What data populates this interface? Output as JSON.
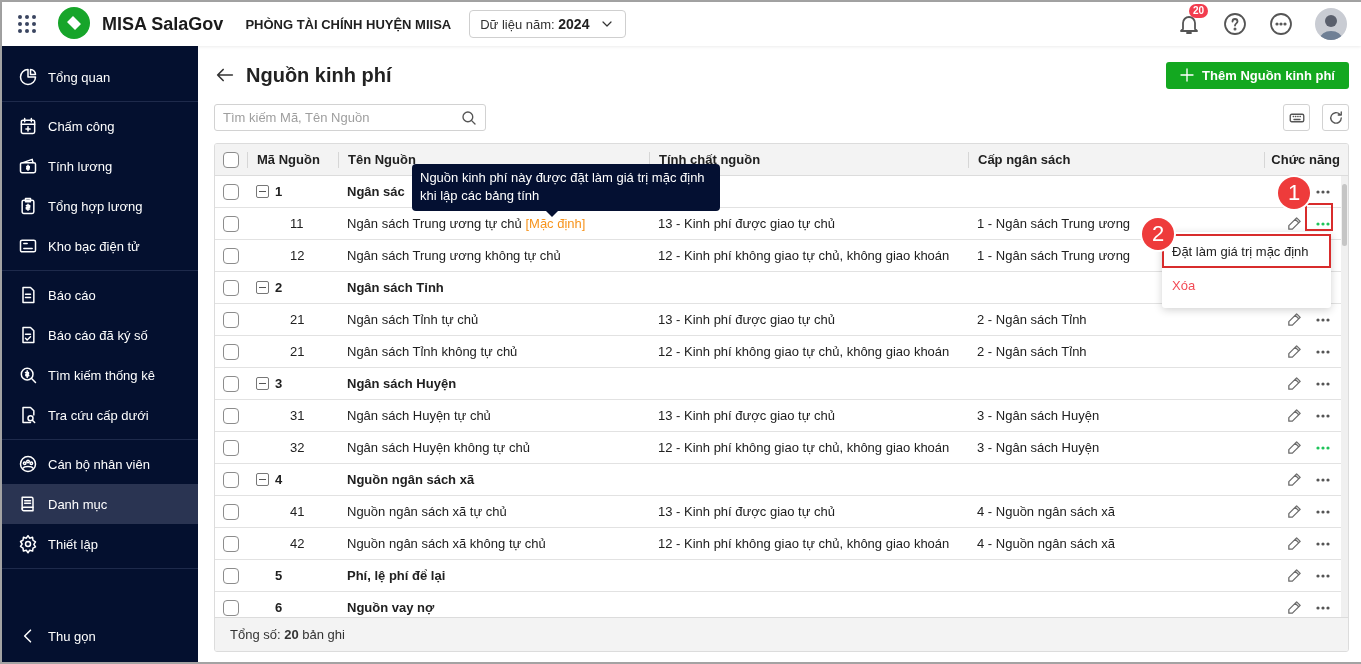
{
  "topbar": {
    "app_name": "MISA SalaGov",
    "org_name": "PHÒNG TÀI CHÍNH HUYỆN MIISA",
    "year_filter": "Dữ liệu năm: **2024**",
    "notification_count": "20"
  },
  "sidebar": {
    "groups": [
      [
        {
          "label": "Tổng quan",
          "selected": false
        }
      ],
      [
        {
          "label": "Chấm công",
          "selected": false
        },
        {
          "label": "Tính lương",
          "selected": false
        },
        {
          "label": "Tổng hợp lương",
          "selected": false
        },
        {
          "label": "Kho bạc điện tử",
          "selected": false
        }
      ],
      [
        {
          "label": "Báo cáo",
          "selected": false
        },
        {
          "label": "Báo cáo đã ký số",
          "selected": false
        },
        {
          "label": "Tìm kiếm thống kê",
          "selected": false
        },
        {
          "label": "Tra cứu cấp dưới",
          "selected": false
        }
      ],
      [
        {
          "label": "Cán bộ nhân viên",
          "selected": false
        },
        {
          "label": "Danh mục",
          "selected": true
        },
        {
          "label": "Thiết lập",
          "selected": false
        }
      ]
    ],
    "collapse_label": "Thu gọn"
  },
  "page": {
    "title": "Nguồn kinh phí",
    "add_button": "Thêm Nguồn kinh phí",
    "search": {
      "placeholder": "Tìm kiếm Mã, Tên Nguồn"
    }
  },
  "table": {
    "header_checked": false,
    "columns": [
      "Mã Nguồn",
      "Tên Nguồn",
      "Tính chất nguồn",
      "Cấp ngân sách",
      "Chức năng"
    ],
    "rows": [
      {
        "kind": "group",
        "expanded": true,
        "checked": false,
        "code": "1",
        "name": "Ngân sác",
        "show_edit": false,
        "show_more": true,
        "more_active": false
      },
      {
        "kind": "item",
        "checked": false,
        "code": "11",
        "name": "Ngân sách Trung ương tự chủ",
        "tag": "[Mặc định]",
        "nature": "13 - Kinh phí được giao tự chủ",
        "level": "1 - Ngân sách Trung ương",
        "show_edit": true,
        "show_more": true,
        "more_active": true
      },
      {
        "kind": "item",
        "checked": false,
        "code": "12",
        "name": "Ngân sách Trung ương không tự chủ",
        "nature": "12 - Kinh phí không giao tự chủ, không giao khoán",
        "level": "1 - Ngân sách Trung ương",
        "show_edit": false,
        "show_more": false
      },
      {
        "kind": "group",
        "expanded": true,
        "checked": false,
        "code": "2",
        "name": "Ngân sách Tỉnh",
        "show_edit": false,
        "show_more": false
      },
      {
        "kind": "item",
        "checked": false,
        "code": "21",
        "name": "Ngân sách Tỉnh tự chủ",
        "nature": "13 - Kinh phí được giao tự chủ",
        "level": "2 - Ngân sách Tỉnh",
        "show_edit": true,
        "show_more": true,
        "more_active": false
      },
      {
        "kind": "item",
        "checked": false,
        "code": "21",
        "name": "Ngân sách Tỉnh không tự chủ",
        "nature": "12 - Kinh phí không giao tự chủ, không giao khoán",
        "level": "2 - Ngân sách Tỉnh",
        "show_edit": true,
        "show_more": true,
        "more_active": false
      },
      {
        "kind": "group",
        "expanded": true,
        "checked": false,
        "code": "3",
        "name": "Ngân sách Huyện",
        "show_edit": true,
        "show_more": true,
        "more_active": false
      },
      {
        "kind": "item",
        "checked": false,
        "code": "31",
        "name": "Ngân sách Huyện tự chủ",
        "nature": "13 - Kinh phí được giao tự chủ",
        "level": "3 - Ngân sách Huyện",
        "show_edit": true,
        "show_more": true,
        "more_active": false
      },
      {
        "kind": "item",
        "checked": false,
        "code": "32",
        "name": "Ngân sách Huyện không tự chủ",
        "nature": "12 - Kinh phí không giao tự chủ, không giao khoán",
        "level": "3 - Ngân sách Huyện",
        "show_edit": true,
        "show_more": true,
        "more_active": true
      },
      {
        "kind": "group",
        "expanded": true,
        "checked": false,
        "code": "4",
        "name": "Nguồn ngân sách xã",
        "show_edit": true,
        "show_more": true,
        "more_active": false
      },
      {
        "kind": "item",
        "checked": false,
        "code": "41",
        "name": "Nguồn ngân sách xã tự chủ",
        "nature": "13 - Kinh phí được giao tự chủ",
        "level": "4 - Nguồn ngân sách xã",
        "show_edit": true,
        "show_more": true,
        "more_active": false
      },
      {
        "kind": "item",
        "checked": false,
        "code": "42",
        "name": "Nguồn ngân sách xã không tự chủ",
        "nature": "12 - Kinh phí không giao tự chủ, không giao khoán",
        "level": "4 - Nguồn ngân sách xã",
        "show_edit": true,
        "show_more": true,
        "more_active": false
      },
      {
        "kind": "single",
        "checked": false,
        "code": "5",
        "name": "Phí, lệ phí để lại",
        "show_edit": true,
        "show_more": true,
        "more_active": false
      },
      {
        "kind": "single",
        "checked": false,
        "code": "6",
        "name": "Nguồn vay nợ",
        "show_edit": true,
        "show_more": true,
        "more_active": false
      }
    ],
    "footer": "Tổng số: **20** bản ghi"
  },
  "tooltip": {
    "text": "Nguồn kinh phí này được đặt làm giá trị mặc định khi lập các bảng tính"
  },
  "menu": {
    "items": [
      {
        "kind": "normal",
        "label": "Đặt làm giá trị mặc định",
        "highlighted": true
      },
      {
        "kind": "danger",
        "label": "Xóa",
        "highlighted": false
      }
    ]
  },
  "annotations": [
    {
      "label": "1",
      "frame": true
    },
    {
      "label": "2",
      "frame": false
    }
  ]
}
